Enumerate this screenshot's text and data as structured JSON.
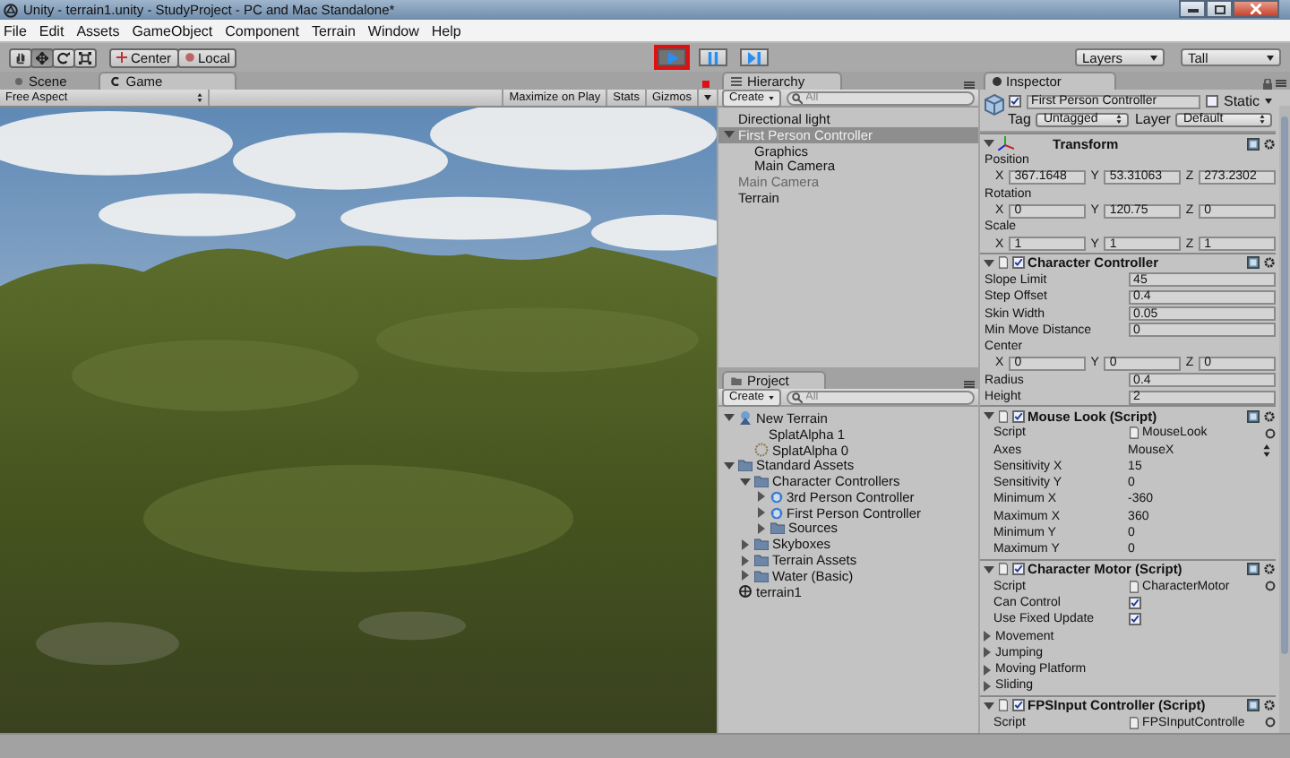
{
  "window": {
    "title": "Unity - terrain1.unity - StudyProject - PC and Mac Standalone*"
  },
  "menu": [
    "File",
    "Edit",
    "Assets",
    "GameObject",
    "Component",
    "Terrain",
    "Window",
    "Help"
  ],
  "toolbar": {
    "tools": [
      {
        "kind": "hand",
        "selected": false
      },
      {
        "kind": "move",
        "selected": true
      },
      {
        "kind": "rotate",
        "selected": false
      },
      {
        "kind": "scale",
        "selected": false
      }
    ],
    "pivot": [
      "Center",
      "Local"
    ],
    "playback": [
      {
        "kind": "play",
        "on": true,
        "highlighted": true
      },
      {
        "kind": "pause",
        "on": false,
        "highlighted": false
      },
      {
        "kind": "step",
        "on": false,
        "highlighted": false
      }
    ],
    "layers": "Layers",
    "layout": "Tall"
  },
  "game_panel": {
    "tabs": [
      {
        "label": "Scene",
        "selected": false
      },
      {
        "label": "Game",
        "selected": true
      }
    ],
    "aspect": "Free Aspect",
    "buttons": [
      "Maximize on Play",
      "Stats",
      "Gizmos"
    ]
  },
  "hierarchy": {
    "title": "Hierarchy",
    "create": "Create",
    "search": {
      "placeholder": "All"
    },
    "items": [
      {
        "label": "Directional light",
        "selected": false,
        "disabled": false
      },
      {
        "label": "First Person Controller",
        "selected": true,
        "disabled": false,
        "expanded": true,
        "children": [
          {
            "label": "Graphics",
            "selected": false,
            "disabled": false
          },
          {
            "label": "Main Camera",
            "selected": false,
            "disabled": false
          }
        ]
      },
      {
        "label": "Main Camera",
        "selected": false,
        "disabled": true
      },
      {
        "label": "Terrain",
        "selected": false,
        "disabled": false
      }
    ]
  },
  "project": {
    "title": "Project",
    "create": "Create",
    "search": {
      "placeholder": "All"
    },
    "items": [
      {
        "label": "New Terrain",
        "kind": "terrain",
        "selected": false,
        "expanded": true,
        "children": [
          {
            "label": "SplatAlpha 1",
            "kind": "plain",
            "selected": false
          },
          {
            "label": "SplatAlpha 0",
            "kind": "texture",
            "selected": false
          }
        ]
      },
      {
        "label": "Standard Assets",
        "kind": "folder",
        "selected": false,
        "expanded": true,
        "children": [
          {
            "label": "Character Controllers",
            "kind": "folder",
            "selected": false,
            "expanded": true,
            "children": [
              {
                "label": "3rd Person Controller",
                "kind": "prefab",
                "selected": false,
                "expanded": false
              },
              {
                "label": "First Person Controller",
                "kind": "prefab",
                "selected": false,
                "expanded": false
              },
              {
                "label": "Sources",
                "kind": "folder",
                "selected": false,
                "expanded": false
              }
            ]
          },
          {
            "label": "Skyboxes",
            "kind": "folder",
            "selected": false,
            "expanded": false
          },
          {
            "label": "Terrain Assets",
            "kind": "folder",
            "selected": false,
            "expanded": false
          },
          {
            "label": "Water (Basic)",
            "kind": "folder",
            "selected": false,
            "expanded": false
          }
        ]
      },
      {
        "label": "terrain1",
        "kind": "scene",
        "selected": false
      }
    ]
  },
  "inspector": {
    "title": "Inspector",
    "object": {
      "name": "First Person Controller",
      "active": true,
      "static_label": "Static",
      "static": false,
      "tag_label": "Tag",
      "tag": "Untagged",
      "layer_label": "Layer",
      "layer": "Default"
    },
    "components": [
      {
        "title": "Transform",
        "kind": "transform",
        "expanded": true,
        "rows": [
          {
            "kind": "label",
            "label": "Position"
          },
          {
            "kind": "vector",
            "fields": [
              {
                "axis": "X",
                "value": "367.1648"
              },
              {
                "axis": "Y",
                "value": "53.31063"
              },
              {
                "axis": "Z",
                "value": "273.2302"
              }
            ]
          },
          {
            "kind": "label",
            "label": "Rotation"
          },
          {
            "kind": "vector",
            "fields": [
              {
                "axis": "X",
                "value": "0"
              },
              {
                "axis": "Y",
                "value": "120.75"
              },
              {
                "axis": "Z",
                "value": "0"
              }
            ]
          },
          {
            "kind": "label",
            "label": "Scale"
          },
          {
            "kind": "vector",
            "fields": [
              {
                "axis": "X",
                "value": "1"
              },
              {
                "axis": "Y",
                "value": "1"
              },
              {
                "axis": "Z",
                "value": "1"
              }
            ]
          }
        ]
      },
      {
        "title": "Character Controller",
        "kind": "script",
        "enabled": true,
        "expanded": true,
        "rows": [
          {
            "kind": "field",
            "label": "Slope Limit",
            "value": "45"
          },
          {
            "kind": "field",
            "label": "Step Offset",
            "value": "0.4"
          },
          {
            "kind": "field",
            "label": "Skin Width",
            "value": "0.05"
          },
          {
            "kind": "field",
            "label": "Min Move Distance",
            "value": "0"
          },
          {
            "kind": "label",
            "label": "Center"
          },
          {
            "kind": "vector",
            "fields": [
              {
                "axis": "X",
                "value": "0"
              },
              {
                "axis": "Y",
                "value": "0"
              },
              {
                "axis": "Z",
                "value": "0"
              }
            ]
          },
          {
            "kind": "field",
            "label": "Radius",
            "value": "0.4"
          },
          {
            "kind": "field",
            "label": "Height",
            "value": "2"
          }
        ]
      },
      {
        "title": "Mouse Look (Script)",
        "kind": "script",
        "enabled": true,
        "expanded": true,
        "rows": [
          {
            "kind": "object",
            "label": "Script",
            "value": "MouseLook"
          },
          {
            "kind": "dropdown",
            "label": "Axes",
            "value": "MouseX"
          },
          {
            "kind": "text",
            "label": "Sensitivity X",
            "value": "15"
          },
          {
            "kind": "text",
            "label": "Sensitivity Y",
            "value": "0"
          },
          {
            "kind": "text",
            "label": "Minimum X",
            "value": "-360"
          },
          {
            "kind": "text",
            "label": "Maximum X",
            "value": "360"
          },
          {
            "kind": "text",
            "label": "Minimum Y",
            "value": "0"
          },
          {
            "kind": "text",
            "label": "Maximum Y",
            "value": "0"
          }
        ]
      },
      {
        "title": "Character Motor (Script)",
        "kind": "script",
        "enabled": true,
        "expanded": true,
        "rows": [
          {
            "kind": "object",
            "label": "Script",
            "value": "CharacterMotor"
          },
          {
            "kind": "checkbox",
            "label": "Can Control",
            "checked": true
          },
          {
            "kind": "checkbox",
            "label": "Use Fixed Update",
            "checked": true
          },
          {
            "kind": "foldout",
            "label": "Movement",
            "expanded": false
          },
          {
            "kind": "foldout",
            "label": "Jumping",
            "expanded": false
          },
          {
            "kind": "foldout",
            "label": "Moving Platform",
            "expanded": false
          },
          {
            "kind": "foldout",
            "label": "Sliding",
            "expanded": false
          }
        ]
      },
      {
        "title": "FPSInput Controller (Script)",
        "kind": "script",
        "enabled": true,
        "expanded": true,
        "rows": [
          {
            "kind": "object",
            "label": "Script",
            "value": "FPSInputControlle"
          }
        ]
      }
    ]
  }
}
